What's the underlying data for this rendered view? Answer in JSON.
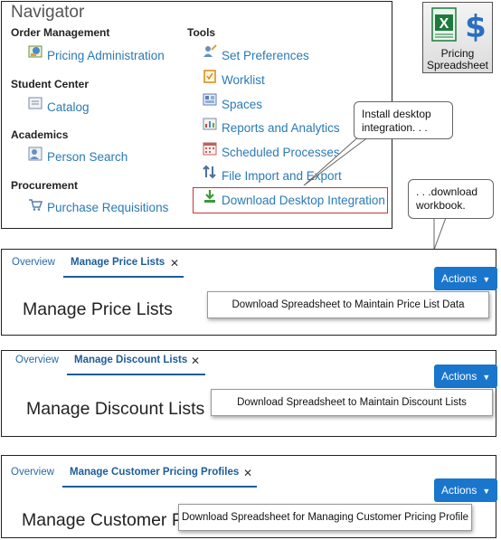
{
  "navigator": {
    "title": "Navigator",
    "sections": {
      "order_management": "Order Management",
      "student_center": "Student Center",
      "academics": "Academics",
      "procurement": "Procurement",
      "tools": "Tools"
    },
    "links": {
      "pricing_administration": "Pricing Administration",
      "catalog": "Catalog",
      "person_search": "Person Search",
      "purchase_requisitions": "Purchase Requisitions",
      "set_preferences": "Set Preferences",
      "worklist": "Worklist",
      "spaces": "Spaces",
      "reports_and_analytics": "Reports and Analytics",
      "scheduled_processes": "Scheduled Processes",
      "file_import_and_export": "File Import and Export",
      "download_desktop_integration": "Download Desktop Integration"
    }
  },
  "pricing_spreadsheet": {
    "line1": "Pricing",
    "line2": "Spreadsheet",
    "colors": {
      "excel_green": "#1e7a3c",
      "dollar_blue": "#2a6fc0"
    }
  },
  "callouts": {
    "install": "Install desktop integration. . .",
    "download": ". . .download workbook."
  },
  "panels": [
    {
      "tabs": {
        "overview": "Overview",
        "active": "Manage Price Lists"
      },
      "heading": "Manage Price Lists",
      "actions": "Actions",
      "menu_item": "Download Spreadsheet to Maintain Price List Data"
    },
    {
      "tabs": {
        "overview": "Overview",
        "active": "Manage Discount Lists"
      },
      "heading": "Manage Discount Lists",
      "actions": "Actions",
      "menu_item": "Download Spreadsheet to Maintain Discount Lists"
    },
    {
      "tabs": {
        "overview": "Overview",
        "active": "Manage Customer Pricing Profiles"
      },
      "heading": "Manage Customer P",
      "actions": "Actions",
      "menu_item": "Download Spreadsheet for Managing Customer Pricing Profile"
    }
  ],
  "colors": {
    "link": "#2a7ab5",
    "actions_button": "#1a75cc",
    "highlight_border": "#cc3333"
  }
}
